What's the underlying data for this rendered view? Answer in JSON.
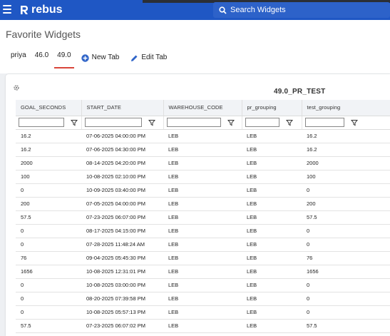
{
  "app": {
    "brand": "rebus",
    "menu_icon": "hamburger-icon",
    "brand_color": "#1f57c4"
  },
  "search": {
    "placeholder": "Search Widgets",
    "icon": "search-icon"
  },
  "page": {
    "title": "Favorite Widgets"
  },
  "tabs": [
    {
      "label": "priya",
      "active": false
    },
    {
      "label": "46.0",
      "active": false
    },
    {
      "label": "49.0",
      "active": true
    }
  ],
  "tab_actions": {
    "new_tab": "New Tab",
    "edit_tab": "Edit Tab",
    "new_tab_icon": "plus-circle-icon",
    "edit_tab_icon": "pencil-icon"
  },
  "widget": {
    "title": "49.0_PR_TEST",
    "settings_icon": "gear-icon",
    "columns": [
      "GOAL_SECONDS",
      "START_DATE",
      "WAREHOUSE_CODE",
      "pr_grouping",
      "test_grouping"
    ],
    "filter_icon": "filter-icon",
    "rows": [
      [
        "16.2",
        "07-06-2025 04:00:00 PM",
        "LEB",
        "LEB",
        "16.2"
      ],
      [
        "16.2",
        "07-06-2025 04:30:00 PM",
        "LEB",
        "LEB",
        "16.2"
      ],
      [
        "2000",
        "08-14-2025 04:20:00 PM",
        "LEB",
        "LEB",
        "2000"
      ],
      [
        "100",
        "10-08-2025 02:10:00 PM",
        "LEB",
        "LEB",
        "100"
      ],
      [
        "0",
        "10-09-2025 03:40:00 PM",
        "LEB",
        "LEB",
        "0"
      ],
      [
        "200",
        "07-05-2025 04:00:00 PM",
        "LEB",
        "LEB",
        "200"
      ],
      [
        "57.5",
        "07-23-2025 06:07:00 PM",
        "LEB",
        "LEB",
        "57.5"
      ],
      [
        "0",
        "08-17-2025 04:15:00 PM",
        "LEB",
        "LEB",
        "0"
      ],
      [
        "0",
        "07-28-2025 11:48:24 AM",
        "LEB",
        "LEB",
        "0"
      ],
      [
        "76",
        "09-04-2025 05:45:30 PM",
        "LEB",
        "LEB",
        "76"
      ],
      [
        "1656",
        "10-08-2025 12:31:01 PM",
        "LEB",
        "LEB",
        "1656"
      ],
      [
        "0",
        "10-08-2025 03:00:00 PM",
        "LEB",
        "LEB",
        "0"
      ],
      [
        "0",
        "08-20-2025 07:39:58 PM",
        "LEB",
        "LEB",
        "0"
      ],
      [
        "0",
        "10-08-2025 05:57:13 PM",
        "LEB",
        "LEB",
        "0"
      ],
      [
        "57.5",
        "07-23-2025 06:07:02 PM",
        "LEB",
        "LEB",
        "57.5"
      ]
    ]
  }
}
